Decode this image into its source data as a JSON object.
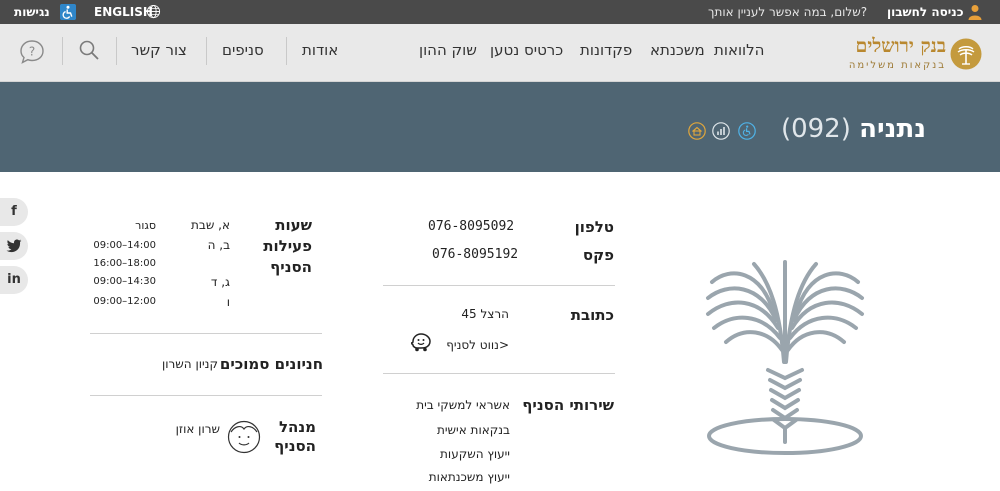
{
  "topbar": {
    "accessibility_label": "נגישות",
    "language_label": "ENGLISH",
    "greeting": "שלום, במה אפשר לעניין אותך?",
    "login_label": "כניסה לחשבון"
  },
  "header": {
    "logo_title": "בנק ירושלים",
    "logo_subtitle": "בנקאות משלימה",
    "nav": [
      "הלוואות",
      "משכנתא",
      "פקדונות",
      "כרטיס נטען",
      "שוק ההון"
    ],
    "secondary_nav": [
      "אודות",
      "סניפים",
      "צור קשר"
    ]
  },
  "banner": {
    "branch_name": "נתניה",
    "branch_number": "(092)"
  },
  "social": [
    "f",
    "in"
  ],
  "contact": {
    "phone_label": "טלפון",
    "phone": "076-8095092",
    "fax_label": "פקס",
    "fax": "076-8095192",
    "address_label": "כתובת",
    "address": "הרצל 45",
    "navigate": "נווט לסניף>"
  },
  "services": {
    "label": "שירותי הסניף",
    "items": [
      "אשראי למשקי בית",
      "בנקאות אישית",
      "ייעוץ השקעות",
      "ייעוץ משכנתאות"
    ]
  },
  "hours": {
    "label_line1": "שעות",
    "label_line2": "פעילות",
    "label_line3": "הסניף",
    "closed_days": "א, שבת",
    "closed": "סגור",
    "row2_days": "ב, ה",
    "row2_time1": "09:00–14:00",
    "row2_time2": "16:00–18:00",
    "row3_days": "ג, ד",
    "row3_time": "09:00–14:30",
    "row4_days": "ו",
    "row4_time": "09:00–12:00"
  },
  "parking": {
    "label": "חניונים סמוכים",
    "value": "קניון השרון"
  },
  "manager": {
    "label_line1": "מנהל",
    "label_line2": "הסניף",
    "name": "שרון אוזן"
  },
  "colors": {
    "topbar": "#4a4a4a",
    "header": "#e9e9e9",
    "banner": "#4f6573",
    "brand_gold": "#b9882f",
    "palm": "#9aa5ad",
    "accessibility_blue": "#2f86c9"
  }
}
